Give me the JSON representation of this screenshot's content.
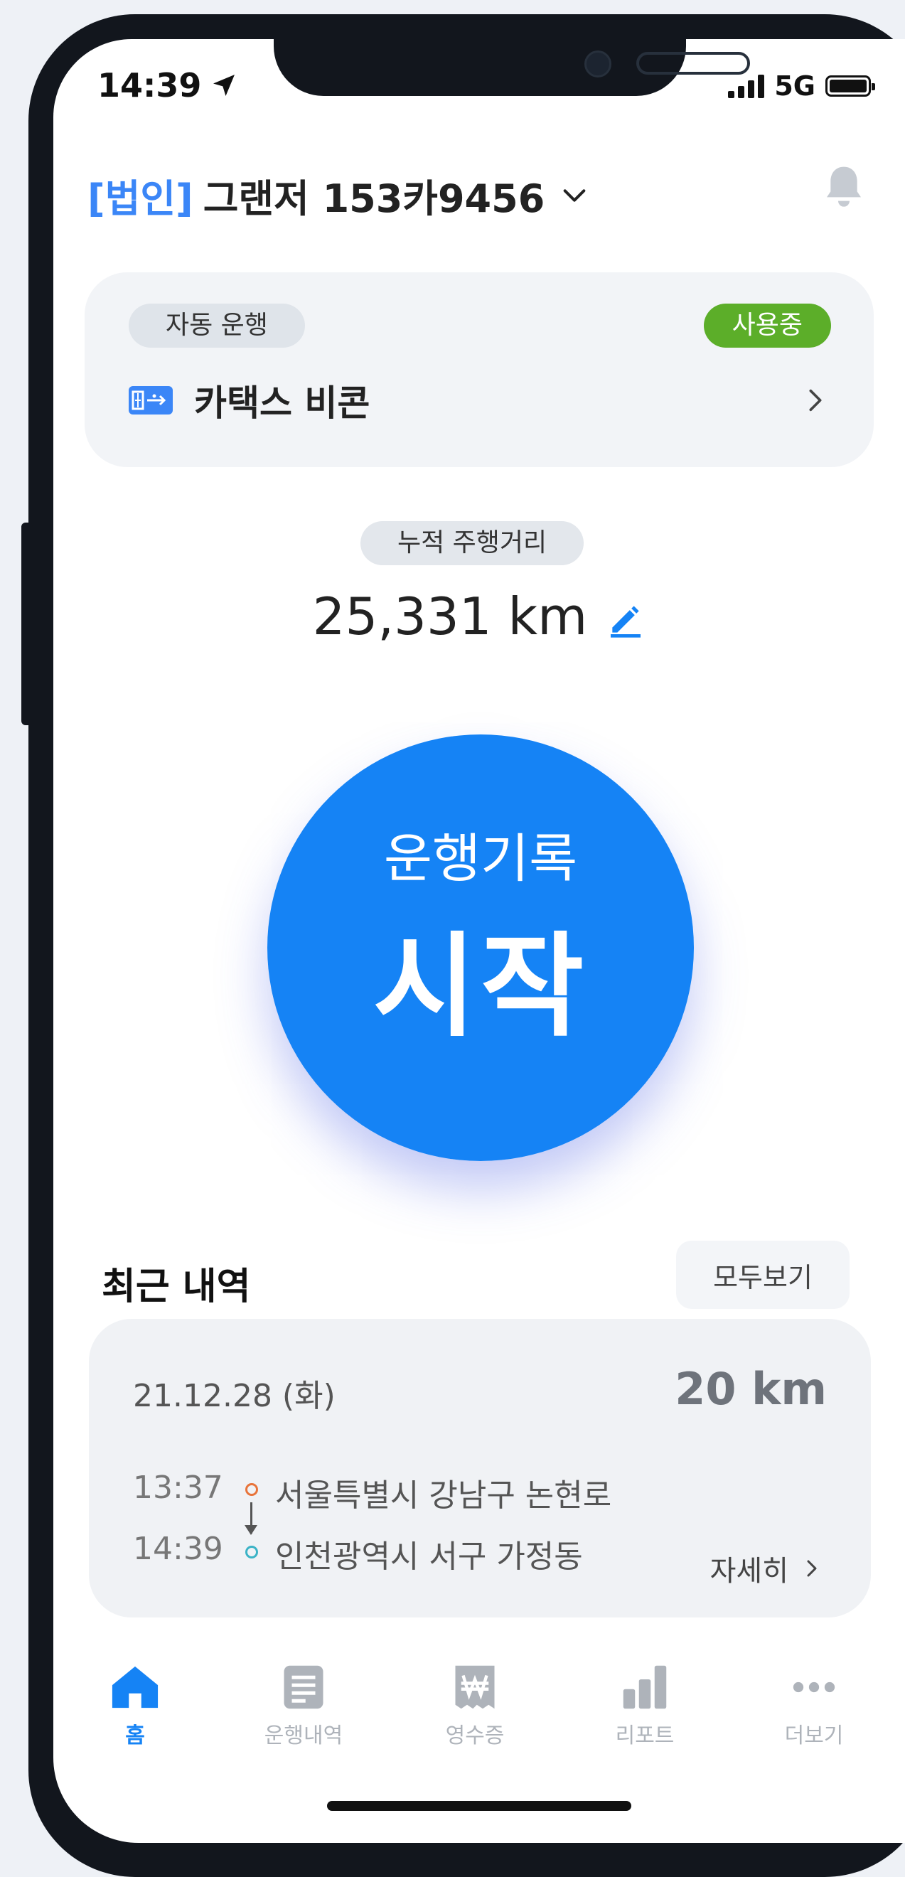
{
  "status": {
    "time": "14:39",
    "network": "5G"
  },
  "header": {
    "corp_tag": "[법인]",
    "vehicle": "그랜저 153카9456"
  },
  "drive_card": {
    "mode_label": "자동 운행",
    "status_badge": "사용중",
    "beacon_label": "카택스 비콘"
  },
  "distance": {
    "label": "누적 주행거리",
    "value": "25,331 km"
  },
  "start_button": {
    "subtitle": "운행기록",
    "title": "시작"
  },
  "recent": {
    "title": "최근 내역",
    "view_all": "모두보기",
    "trip": {
      "date": "21.12.28 (화)",
      "distance": "20 km",
      "start_time": "13:37",
      "start_address": "서울특별시 강남구 논현로",
      "end_time": "14:39",
      "end_address": "인천광역시 서구 가정동",
      "detail": "자세히"
    }
  },
  "tabs": [
    {
      "label": "홈",
      "icon": "home-icon"
    },
    {
      "label": "운행내역",
      "icon": "document-icon"
    },
    {
      "label": "영수증",
      "icon": "receipt-icon"
    },
    {
      "label": "리포트",
      "icon": "chart-icon"
    },
    {
      "label": "더보기",
      "icon": "more-icon"
    }
  ],
  "colors": {
    "accent": "#1583f5",
    "active_badge": "#5cae29",
    "tab_inactive": "#aeb3ba"
  }
}
